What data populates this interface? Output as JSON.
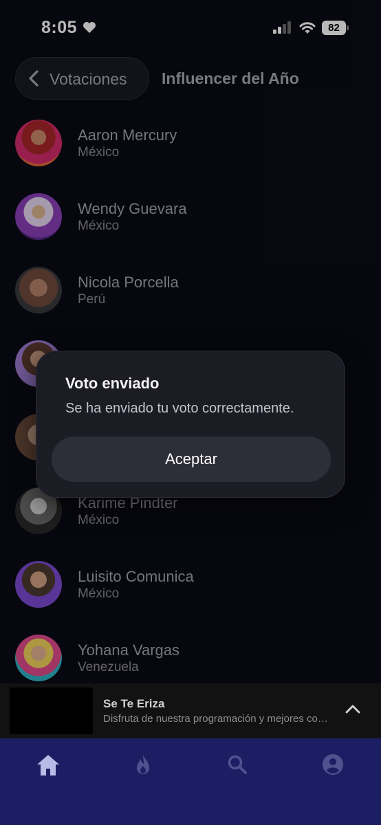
{
  "status_bar": {
    "time": "8:05",
    "battery": "82"
  },
  "header": {
    "back_label": "Votaciones",
    "title": "Influencer del Año"
  },
  "nominees": [
    {
      "name": "Aaron Mercury",
      "country": "México"
    },
    {
      "name": "Wendy Guevara",
      "country": "México"
    },
    {
      "name": "Nicola Porcella",
      "country": "Perú"
    },
    {
      "name": "Karime Pindter",
      "country": "México"
    },
    {
      "name": "Luisito Comunica",
      "country": "México"
    },
    {
      "name": "Yohana Vargas",
      "country": "Venezuela"
    }
  ],
  "alert": {
    "title": "Voto enviado",
    "message": "Se ha enviado tu voto correctamente.",
    "button": "Aceptar"
  },
  "mini_player": {
    "title": "Se Te Eriza",
    "subtitle": "Disfruta de nuestra programación y mejores contenidos"
  },
  "tab_bar": {
    "icons": [
      "home-icon",
      "flame-icon",
      "search-icon",
      "account-icon"
    ],
    "active": "home-icon"
  },
  "colors": {
    "background": "#0b0c16",
    "tab_bar": "#1c1e63",
    "alert_surface": "#1b1c24",
    "alert_button": "#2d2e37"
  }
}
